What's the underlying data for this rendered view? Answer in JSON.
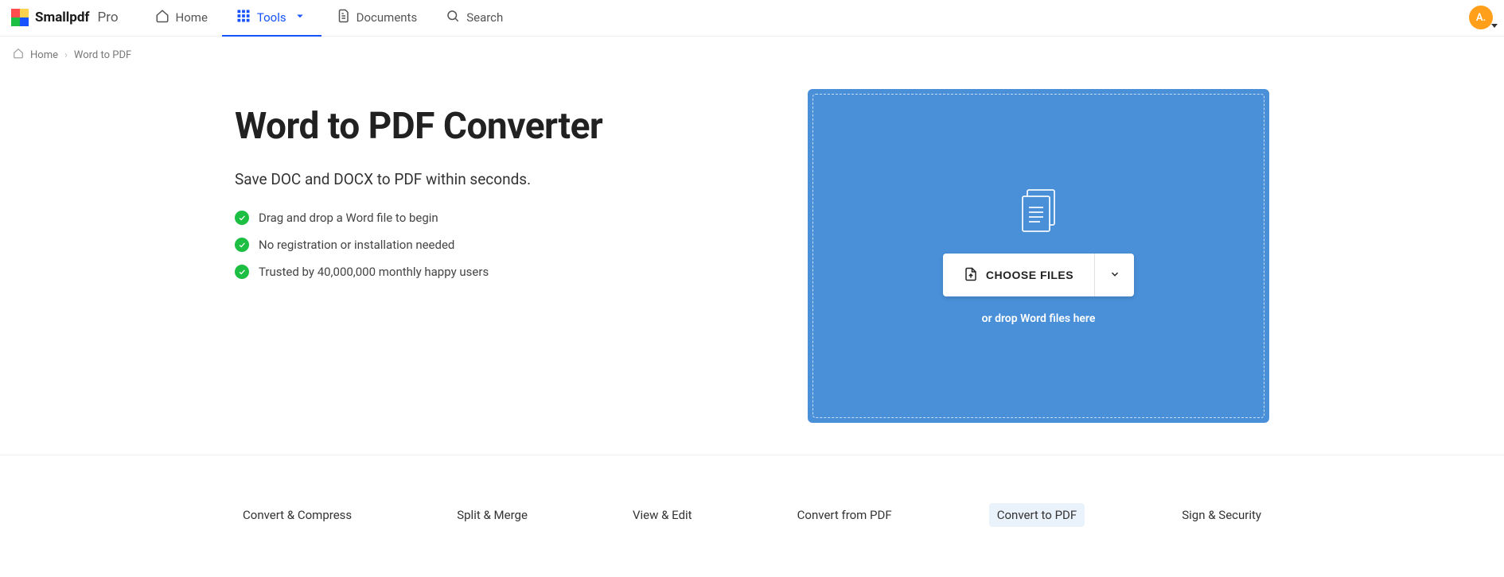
{
  "brand": {
    "name": "Smallpdf",
    "tier": "Pro"
  },
  "nav": {
    "home": "Home",
    "tools": "Tools",
    "documents": "Documents",
    "search": "Search"
  },
  "avatar": {
    "initial": "A."
  },
  "breadcrumb": {
    "home": "Home",
    "current": "Word to PDF"
  },
  "hero": {
    "title": "Word to PDF Converter",
    "subtitle": "Save DOC and DOCX to PDF within seconds.",
    "bullets": [
      "Drag and drop a Word file to begin",
      "No registration or installation needed",
      "Trusted by 40,000,000 monthly happy users"
    ]
  },
  "dropzone": {
    "choose_label": "CHOOSE FILES",
    "hint": "or drop Word files here"
  },
  "categories": [
    "Convert & Compress",
    "Split & Merge",
    "View & Edit",
    "Convert from PDF",
    "Convert to PDF",
    "Sign & Security"
  ],
  "categories_active_index": 4,
  "colors": {
    "accent": "#1752ff",
    "drop_bg": "#4a90d9",
    "success": "#1dbf43",
    "avatar": "#ff9f1a"
  }
}
